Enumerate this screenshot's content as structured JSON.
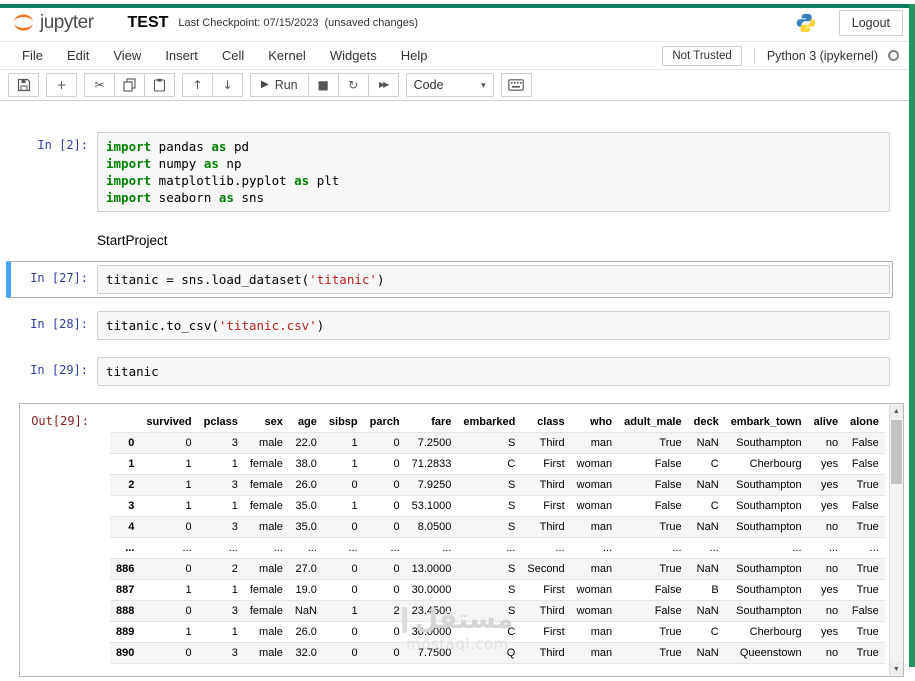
{
  "colors": {
    "jupyter_orange": "#f37626",
    "recording_border_top": "#0d7d5d",
    "recording_border_right": "#21965e",
    "selected_cell_accent": "#42a5f5",
    "in_prompt": "#303f9f",
    "out_prompt": "#8b1a1a",
    "keyword_green": "#008000",
    "string_red": "#ba2121"
  },
  "header": {
    "logo_text": "jupyter",
    "title": "TEST",
    "checkpoint": "Last Checkpoint: 07/15/2023",
    "autosave": "(unsaved changes)",
    "logout": "Logout"
  },
  "menu": {
    "items": [
      {
        "id": "file",
        "label": "File"
      },
      {
        "id": "edit",
        "label": "Edit"
      },
      {
        "id": "view",
        "label": "View"
      },
      {
        "id": "insert",
        "label": "Insert"
      },
      {
        "id": "cell",
        "label": "Cell"
      },
      {
        "id": "kernel",
        "label": "Kernel"
      },
      {
        "id": "widgets",
        "label": "Widgets"
      },
      {
        "id": "help",
        "label": "Help"
      }
    ],
    "not_trusted": "Not Trusted",
    "kernel": "Python 3 (ipykernel)"
  },
  "toolbar": {
    "run_label": "Run",
    "cell_type": "Code",
    "icons": {
      "plus": "+",
      "cut": "✂",
      "up": "↑",
      "down": "↓",
      "run": "▶",
      "stop": "■",
      "restart": "↻",
      "fastforward": "▶▶",
      "chevron": "▾"
    }
  },
  "cells": [
    {
      "type": "code",
      "prompt": "In [2]:",
      "lines": [
        [
          [
            "kw",
            "import"
          ],
          [
            "pl",
            " pandas "
          ],
          [
            "kw",
            "as"
          ],
          [
            "pl",
            " pd"
          ]
        ],
        [
          [
            "kw",
            "import"
          ],
          [
            "pl",
            " numpy "
          ],
          [
            "kw",
            "as"
          ],
          [
            "pl",
            " np"
          ]
        ],
        [
          [
            "kw",
            "import"
          ],
          [
            "pl",
            " matplotlib.pyplot "
          ],
          [
            "kw",
            "as"
          ],
          [
            "pl",
            " plt"
          ]
        ],
        [
          [
            "kw",
            "import"
          ],
          [
            "pl",
            " seaborn "
          ],
          [
            "kw",
            "as"
          ],
          [
            "pl",
            " sns"
          ]
        ]
      ]
    },
    {
      "type": "markdown",
      "text": "StartProject"
    },
    {
      "type": "code",
      "prompt": "In [27]:",
      "selected": true,
      "lines": [
        [
          [
            "pl",
            "titanic = sns.load_dataset("
          ],
          [
            "str",
            "'titanic'"
          ],
          [
            "pl",
            ")"
          ]
        ]
      ]
    },
    {
      "type": "code",
      "prompt": "In [28]:",
      "lines": [
        [
          [
            "pl",
            "titanic.to_csv("
          ],
          [
            "str",
            "'titanic.csv'"
          ],
          [
            "pl",
            ")"
          ]
        ]
      ]
    },
    {
      "type": "code",
      "prompt": "In [29]:",
      "lines": [
        [
          [
            "pl",
            "titanic"
          ]
        ]
      ]
    }
  ],
  "output": {
    "prompt": "Out[29]:",
    "scrollbar": {
      "up": "▲",
      "down": "▼"
    },
    "table": {
      "index_header": "",
      "columns": [
        "survived",
        "pclass",
        "sex",
        "age",
        "sibsp",
        "parch",
        "fare",
        "embarked",
        "class",
        "who",
        "adult_male",
        "deck",
        "embark_town",
        "alive",
        "alone"
      ],
      "rows": [
        {
          "index": "0",
          "values": [
            "0",
            "3",
            "male",
            "22.0",
            "1",
            "0",
            "7.2500",
            "S",
            "Third",
            "man",
            "True",
            "NaN",
            "Southampton",
            "no",
            "False"
          ]
        },
        {
          "index": "1",
          "values": [
            "1",
            "1",
            "female",
            "38.0",
            "1",
            "0",
            "71.2833",
            "C",
            "First",
            "woman",
            "False",
            "C",
            "Cherbourg",
            "yes",
            "False"
          ]
        },
        {
          "index": "2",
          "values": [
            "1",
            "3",
            "female",
            "26.0",
            "0",
            "0",
            "7.9250",
            "S",
            "Third",
            "woman",
            "False",
            "NaN",
            "Southampton",
            "yes",
            "True"
          ]
        },
        {
          "index": "3",
          "values": [
            "1",
            "1",
            "female",
            "35.0",
            "1",
            "0",
            "53.1000",
            "S",
            "First",
            "woman",
            "False",
            "C",
            "Southampton",
            "yes",
            "False"
          ]
        },
        {
          "index": "4",
          "values": [
            "0",
            "3",
            "male",
            "35.0",
            "0",
            "0",
            "8.0500",
            "S",
            "Third",
            "man",
            "True",
            "NaN",
            "Southampton",
            "no",
            "True"
          ]
        },
        {
          "index": "...",
          "values": [
            "...",
            "...",
            "...",
            "...",
            "...",
            "...",
            "...",
            "...",
            "...",
            "...",
            "...",
            "...",
            "...",
            "...",
            "..."
          ]
        },
        {
          "index": "886",
          "values": [
            "0",
            "2",
            "male",
            "27.0",
            "0",
            "0",
            "13.0000",
            "S",
            "Second",
            "man",
            "True",
            "NaN",
            "Southampton",
            "no",
            "True"
          ]
        },
        {
          "index": "887",
          "values": [
            "1",
            "1",
            "female",
            "19.0",
            "0",
            "0",
            "30.0000",
            "S",
            "First",
            "woman",
            "False",
            "B",
            "Southampton",
            "yes",
            "True"
          ]
        },
        {
          "index": "888",
          "values": [
            "0",
            "3",
            "female",
            "NaN",
            "1",
            "2",
            "23.4500",
            "S",
            "Third",
            "woman",
            "False",
            "NaN",
            "Southampton",
            "no",
            "False"
          ]
        },
        {
          "index": "889",
          "values": [
            "1",
            "1",
            "male",
            "26.0",
            "0",
            "0",
            "30.0000",
            "C",
            "First",
            "man",
            "True",
            "C",
            "Cherbourg",
            "yes",
            "True"
          ]
        },
        {
          "index": "890",
          "values": [
            "0",
            "3",
            "male",
            "32.0",
            "0",
            "0",
            "7.7500",
            "Q",
            "Third",
            "man",
            "True",
            "NaN",
            "Queenstown",
            "no",
            "True"
          ]
        }
      ]
    }
  },
  "watermark": {
    "line1": "مستقل",
    "line2": "mostaql.com"
  }
}
